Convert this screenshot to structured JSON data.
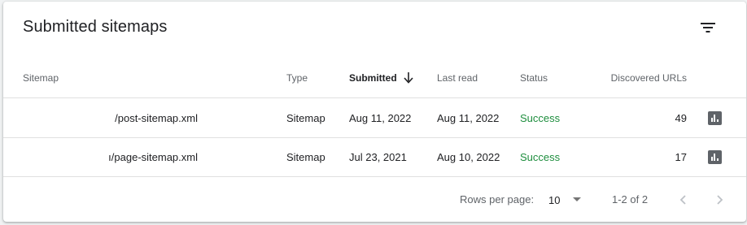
{
  "card": {
    "title": "Submitted sitemaps",
    "filter_icon": "filter-list-icon"
  },
  "table": {
    "headers": {
      "sitemap": "Sitemap",
      "type": "Type",
      "submitted": "Submitted",
      "last_read": "Last read",
      "status": "Status",
      "discovered_urls": "Discovered URLs"
    },
    "sort": {
      "column": "submitted",
      "direction": "descending",
      "icon": "arrow-down-icon"
    },
    "rows": [
      {
        "sitemap": "/post-sitemap.xml",
        "type": "Sitemap",
        "submitted": "Aug 11, 2022",
        "last_read": "Aug 11, 2022",
        "status": "Success",
        "discovered_urls": "49",
        "action_icon": "bar-chart-icon"
      },
      {
        "sitemap": "ı/page-sitemap.xml",
        "type": "Sitemap",
        "submitted": "Jul 23, 2021",
        "last_read": "Aug 10, 2022",
        "status": "Success",
        "discovered_urls": "17",
        "action_icon": "bar-chart-icon"
      }
    ]
  },
  "pagination": {
    "rows_per_page_label": "Rows per page:",
    "rows_per_page_value": "10",
    "range": "1-2 of 2",
    "prev_icon": "chevron-left-icon",
    "next_icon": "chevron-right-icon"
  },
  "colors": {
    "success": "#1e8e3e",
    "icon_gray": "#5f6368",
    "divider": "#e0e0e0"
  }
}
